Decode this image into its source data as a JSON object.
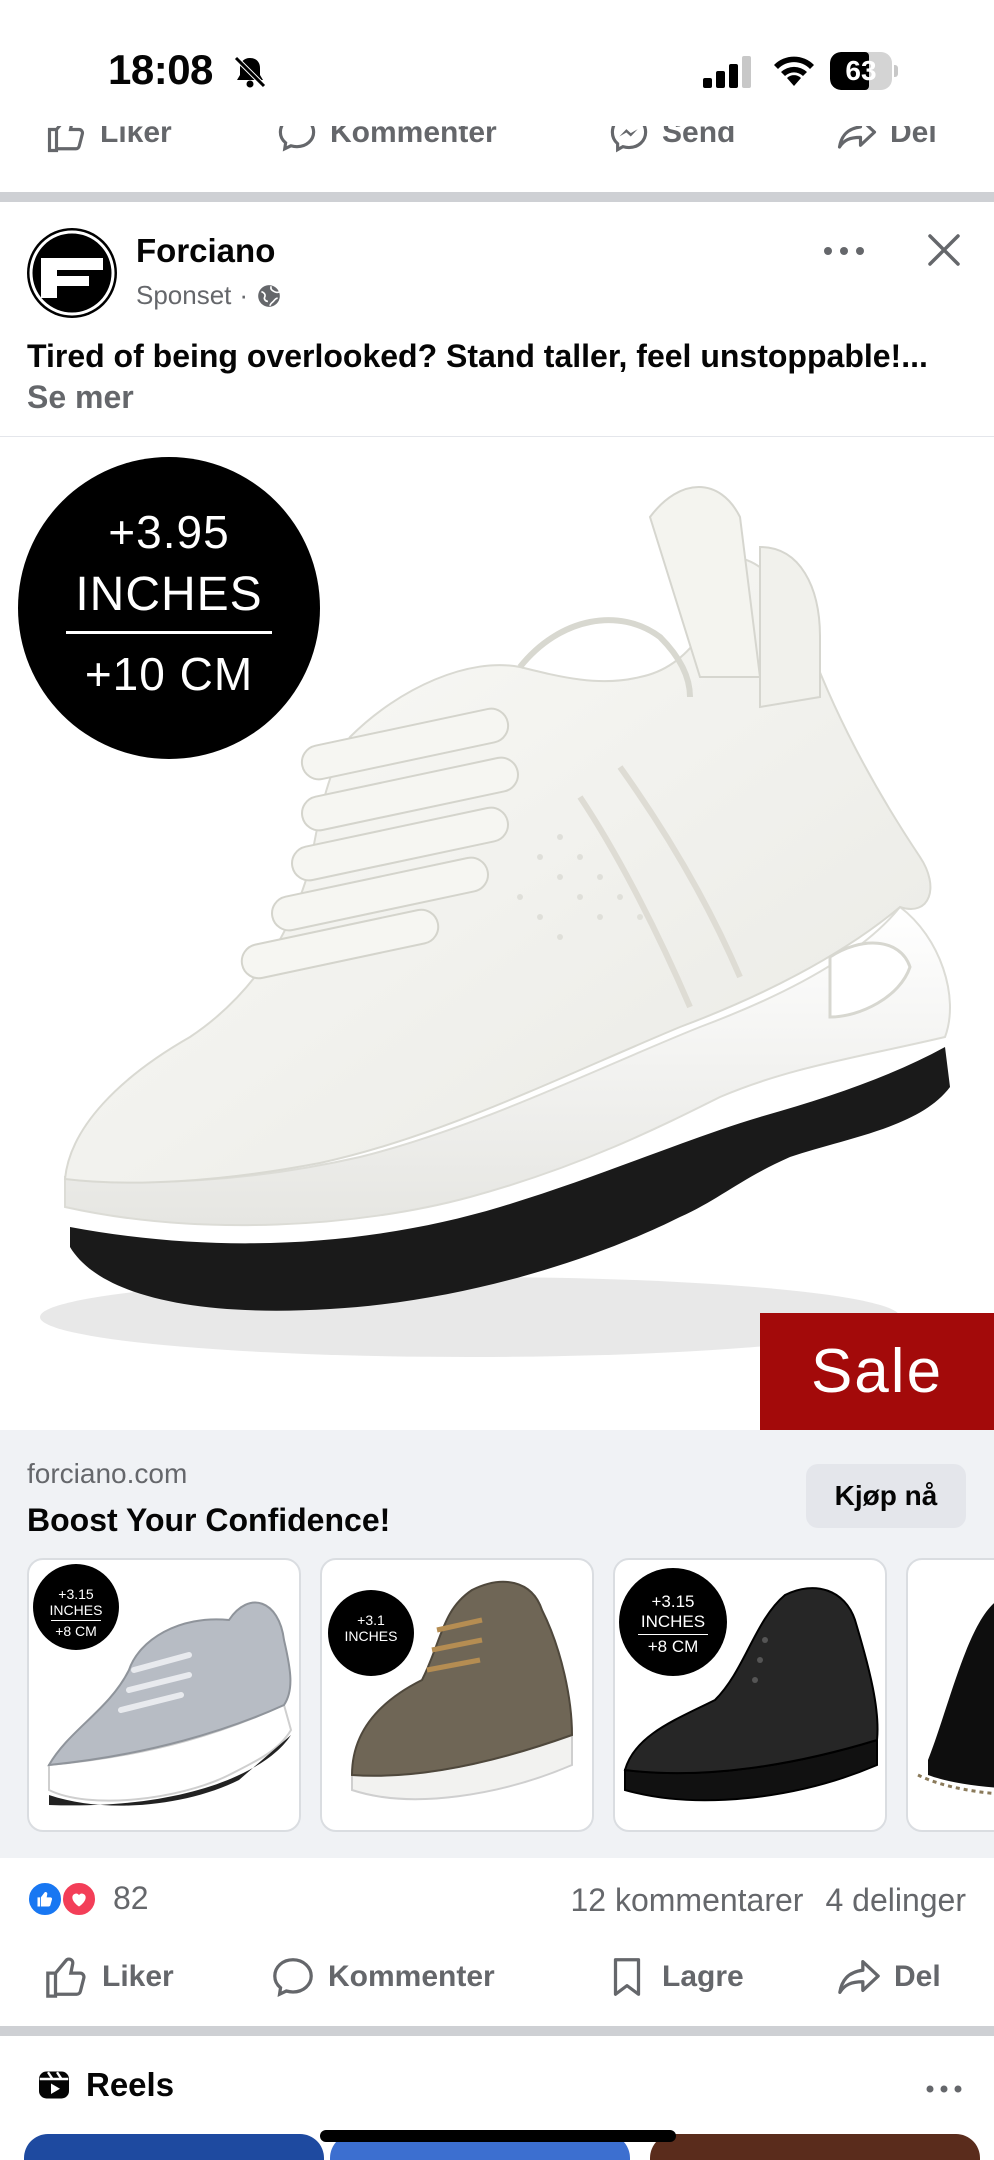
{
  "status_bar": {
    "time": "18:08",
    "battery": "63",
    "battery_level_percent": 63
  },
  "prev_post_actions": {
    "like": "Liker",
    "comment": "Kommenter",
    "send": "Send",
    "share": "Del"
  },
  "post": {
    "page_name": "Forciano",
    "sponsored": "Sponset",
    "text": "Tired of being overlooked? Stand taller, feel unstoppable!...",
    "see_more": "Se mer"
  },
  "ad_image": {
    "badge_line1": "+3.95",
    "badge_line2": "INCHES",
    "badge_line3": "+10 CM",
    "sale_label": "Sale",
    "colors": {
      "sale": "#a30a0a",
      "badge": "#000000"
    }
  },
  "link": {
    "domain": "forciano.com",
    "headline": "Boost Your Confidence!",
    "cta": "Kjøp nå"
  },
  "carousel": [
    {
      "badge": [
        "+3.15",
        "INCHES",
        "+8 CM"
      ],
      "shoe": "grey-knit-sneaker"
    },
    {
      "badge": [
        "+3.1",
        "INCHES"
      ],
      "shoe": "olive-high-top-sneaker"
    },
    {
      "badge": [
        "+3.15",
        "INCHES",
        "+8 CM"
      ],
      "shoe": "black-high-top-sneaker"
    },
    {
      "badge": [],
      "shoe": "black-leather-boot"
    }
  ],
  "engagement": {
    "reaction_count": "82",
    "comments": "12 kommentarer",
    "shares": "4 delinger"
  },
  "actions": {
    "like": "Liker",
    "comment": "Kommenter",
    "save": "Lagre",
    "share": "Del"
  },
  "reels": {
    "title": "Reels"
  }
}
